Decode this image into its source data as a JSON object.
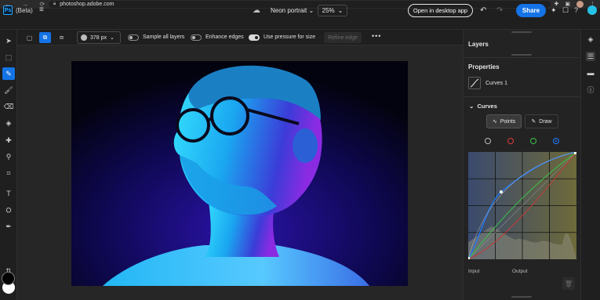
{
  "browser": {
    "nav": "← → ⟳",
    "url": "photoshop.adobe.com"
  },
  "header": {
    "app_badge": "Ps",
    "beta_label": "(Beta)",
    "document_name": "Neon portrait",
    "zoom": "25%",
    "open_desktop_label": "Open in desktop app",
    "share_label": "Share"
  },
  "options": {
    "brush_size": "378 px",
    "sample_all_layers_label": "Sample all layers",
    "sample_all_layers_on": false,
    "enhance_edges_label": "Enhance edges",
    "enhance_edges_on": false,
    "use_pressure_label": "Use pressure for size",
    "use_pressure_on": true,
    "refine_edge_label": "Refine edge"
  },
  "panels": {
    "layers_title": "Layers",
    "properties_title": "Properties",
    "adjustment_name": "Curves 1",
    "curves_section": "Curves",
    "points_label": "Points",
    "draw_label": "Draw",
    "input_label": "Input",
    "output_label": "Output",
    "channels": [
      {
        "name": "rgb",
        "color": "#bdbdbd"
      },
      {
        "name": "red",
        "color": "#e03a3a"
      },
      {
        "name": "green",
        "color": "#3ac24a"
      },
      {
        "name": "blue",
        "color": "#1f7bff"
      }
    ],
    "selected_channel": "blue"
  },
  "colors": {
    "accent": "#1473e6",
    "foreground": "#000000",
    "background": "#ffffff"
  }
}
